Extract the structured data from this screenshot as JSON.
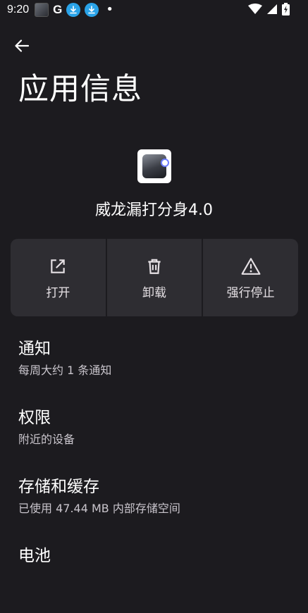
{
  "status_bar": {
    "time": "9:20",
    "google_letter": "G"
  },
  "header": {
    "title": "应用信息"
  },
  "app": {
    "name": "威龙漏打分身4.0"
  },
  "actions": [
    {
      "label": "打开",
      "icon": "open-external-icon"
    },
    {
      "label": "卸载",
      "icon": "trash-icon"
    },
    {
      "label": "强行停止",
      "icon": "warning-icon"
    }
  ],
  "settings": [
    {
      "title": "通知",
      "subtitle": "每周大约 1 条通知"
    },
    {
      "title": "权限",
      "subtitle": "附近的设备"
    },
    {
      "title": "存储和缓存",
      "subtitle": "已使用 47.44 MB 内部存储空间"
    },
    {
      "title": "电池",
      "subtitle": ""
    }
  ],
  "colors": {
    "background": "#1c1b1f",
    "card": "#2e2d32",
    "download_badge": "#2aa3e8"
  }
}
